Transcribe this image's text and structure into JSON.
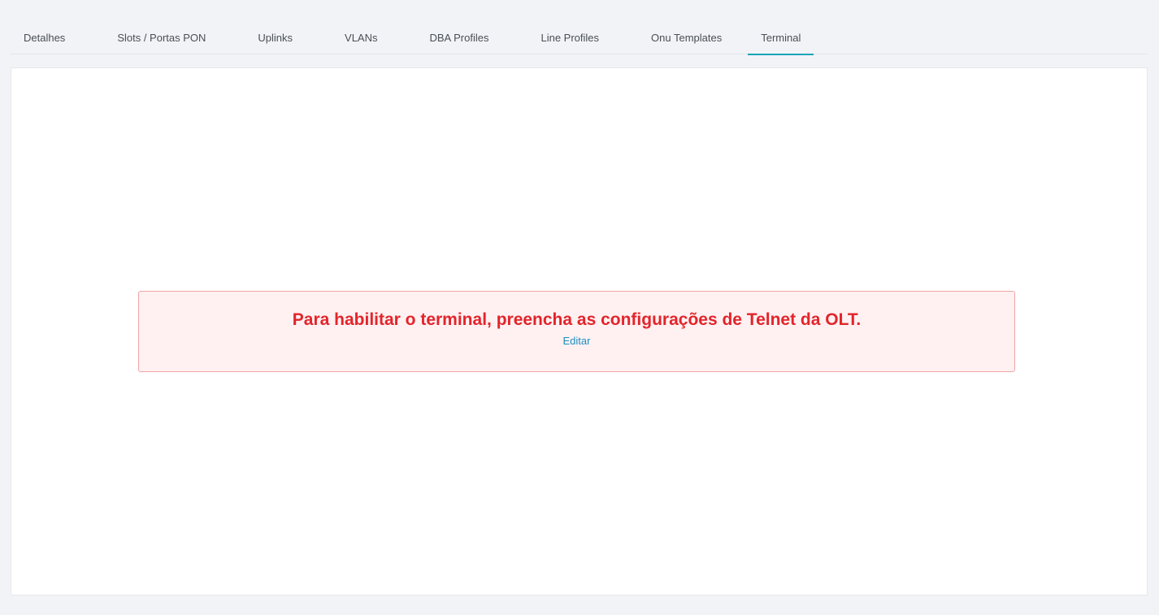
{
  "tabs": [
    {
      "label": "Detalhes",
      "active": false
    },
    {
      "label": "Slots / Portas PON",
      "active": false
    },
    {
      "label": "Uplinks",
      "active": false
    },
    {
      "label": "VLANs",
      "active": false
    },
    {
      "label": "DBA Profiles",
      "active": false
    },
    {
      "label": "Line Profiles",
      "active": false
    },
    {
      "label": "Onu Templates",
      "active": false
    },
    {
      "label": "Terminal",
      "active": true
    }
  ],
  "alert": {
    "message": "Para habilitar o terminal, preencha as configurações de Telnet da OLT.",
    "link_label": "Editar"
  },
  "colors": {
    "active_tab_indicator": "#17a2b8",
    "alert_text": "#e3242b",
    "alert_background": "#fff1f1",
    "alert_border": "#f0a5a8",
    "link": "#1b8ec4"
  }
}
